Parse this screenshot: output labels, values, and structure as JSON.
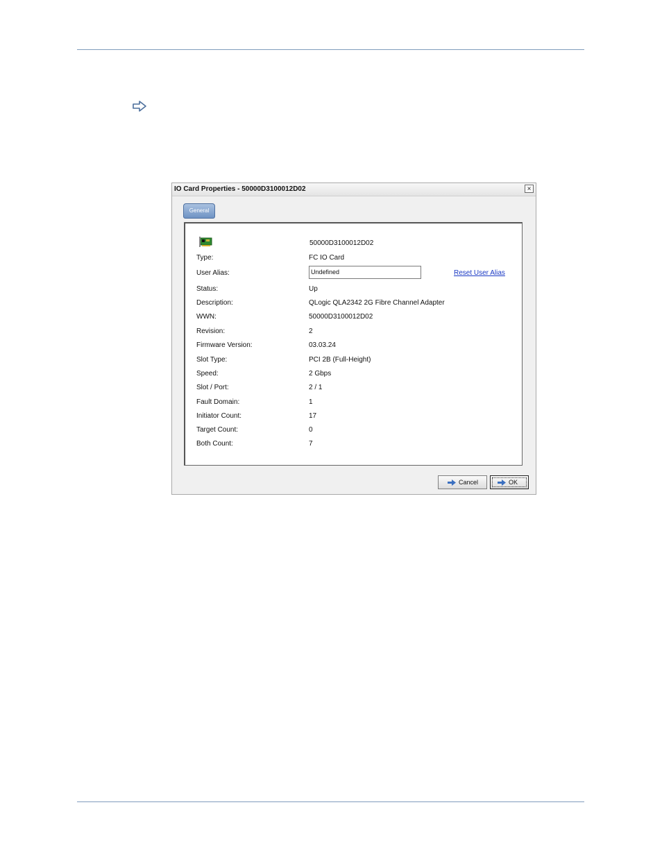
{
  "dialog": {
    "title": "IO Card Properties - 50000D3100012D02",
    "close_glyph": "×",
    "tab_general": "General",
    "card_id": "50000D3100012D02",
    "reset_link": "Reset User Alias",
    "rows": [
      {
        "label": "Type:",
        "value": "FC IO Card"
      },
      {
        "label": "User Alias:",
        "value": "Undefined"
      },
      {
        "label": "Status:",
        "value": "Up"
      },
      {
        "label": "Description:",
        "value": "QLogic QLA2342 2G Fibre Channel Adapter"
      },
      {
        "label": "WWN:",
        "value": "50000D3100012D02"
      },
      {
        "label": "Revision:",
        "value": "2"
      },
      {
        "label": "Firmware Version:",
        "value": "03.03.24"
      },
      {
        "label": "Slot Type:",
        "value": "PCI 2B (Full-Height)"
      },
      {
        "label": "Speed:",
        "value": "2 Gbps"
      },
      {
        "label": "Slot / Port:",
        "value": "2 / 1"
      },
      {
        "label": "Fault Domain:",
        "value": "1"
      },
      {
        "label": "Initiator Count:",
        "value": "17"
      },
      {
        "label": "Target Count:",
        "value": "0"
      },
      {
        "label": "Both Count:",
        "value": "7"
      }
    ],
    "buttons": {
      "cancel": "Cancel",
      "ok": "OK"
    }
  },
  "icons": {
    "note_arrow": "arrow-right-outline-icon",
    "card": "fc-io-card-icon",
    "button_arrow": "blue-arrow-icon"
  },
  "colors": {
    "rule": "#7f9cbc",
    "link": "#1a39c4",
    "tab": "#6f93c4"
  }
}
